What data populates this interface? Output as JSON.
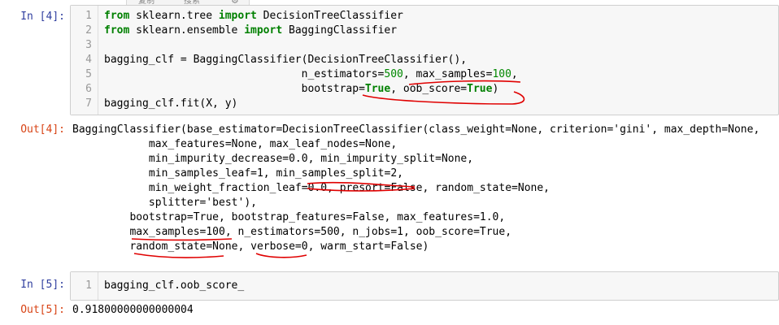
{
  "tooltip": {
    "copy": "复制",
    "search": "搜索"
  },
  "cells": {
    "in4": {
      "prompt": "In  [4]:",
      "lines": [
        {
          "no": "1",
          "kw1": "from",
          "t1": " sklearn.tree ",
          "kw2": "import",
          "t2": " DecisionTreeClassifier"
        },
        {
          "no": "2",
          "kw1": "from",
          "t1": " sklearn.ensemble ",
          "kw2": "import",
          "t2": " BaggingClassifier"
        },
        {
          "no": "3"
        },
        {
          "no": "4",
          "text": "bagging_clf = BaggingClassifier(DecisionTreeClassifier(),"
        },
        {
          "no": "5",
          "a": "                               n_estimators=",
          "n1": "500",
          "b": ", max_samples=",
          "n2": "100",
          "c": ","
        },
        {
          "no": "6",
          "a": "                               bootstrap=",
          "k1": "True",
          "b": ", oob_score=",
          "k2": "True",
          "c": ")"
        },
        {
          "no": "7",
          "text": "bagging_clf.fit(X, y)"
        }
      ]
    },
    "out4": {
      "prompt": "Out[4]:",
      "lines": [
        "BaggingClassifier(base_estimator=DecisionTreeClassifier(class_weight=None, criterion='gini', max_depth=None,",
        "            max_features=None, max_leaf_nodes=None,",
        "            min_impurity_decrease=0.0, min_impurity_split=None,",
        "            min_samples_leaf=1, min_samples_split=2,",
        "            min_weight_fraction_leaf=0.0, presort=False, random_state=None,",
        "            splitter='best'),",
        "         bootstrap=True, bootstrap_features=False, max_features=1.0,",
        "         max_samples=100, n_estimators=500, n_jobs=1, oob_score=True,",
        "         random_state=None, verbose=0, warm_start=False)"
      ]
    },
    "in5": {
      "prompt": "In  [5]:",
      "lines": [
        {
          "no": "1",
          "text": "bagging_clf.oob_score_"
        }
      ]
    },
    "out5": {
      "prompt": "Out[5]:",
      "text": "0.91800000000000004"
    }
  },
  "colors": {
    "in_prompt": "#303f9f",
    "out_prompt": "#d84315",
    "keyword": "#008000",
    "number": "#008800",
    "ink": "#e00000"
  }
}
